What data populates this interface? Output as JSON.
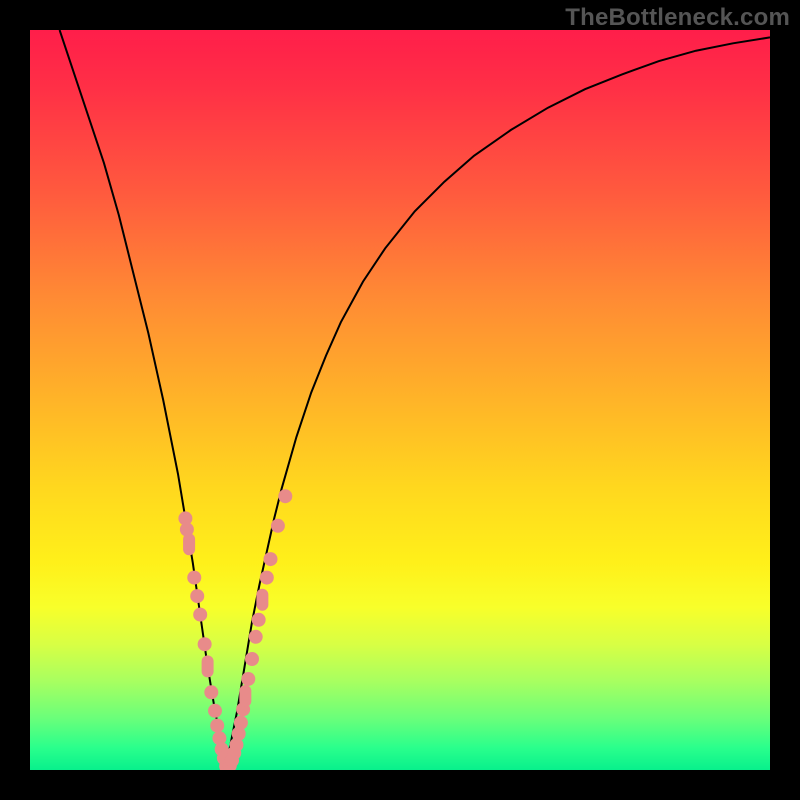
{
  "watermark_text": "TheBottleneck.com",
  "colors": {
    "frame": "#000000",
    "curve": "#000000",
    "points": "#e88b8a",
    "gradient_stops": [
      "#ff1e4a",
      "#ff3046",
      "#ff5a3e",
      "#ff8a34",
      "#ffb428",
      "#ffd81e",
      "#fff01a",
      "#f8ff2a",
      "#d8ff44",
      "#a8ff60",
      "#6aff7a",
      "#2aff8c",
      "#08f08c"
    ]
  },
  "chart_data": {
    "type": "line",
    "title": "",
    "xlabel": "",
    "ylabel": "",
    "xlim": [
      0,
      100
    ],
    "ylim": [
      0,
      100
    ],
    "x_min_curve": 26.5,
    "series": [
      {
        "name": "bottleneck-curve",
        "x": [
          4,
          6,
          8,
          10,
          12,
          14,
          16,
          18,
          20,
          21,
          22,
          23,
          24,
          25,
          26,
          26.5,
          27,
          28,
          29,
          30,
          31,
          32,
          33,
          34,
          36,
          38,
          40,
          42,
          45,
          48,
          52,
          56,
          60,
          65,
          70,
          75,
          80,
          85,
          90,
          95,
          100
        ],
        "y": [
          100,
          94,
          88,
          82,
          75,
          67,
          59,
          50,
          40,
          34,
          28,
          21,
          14,
          8,
          3,
          0.5,
          3,
          8,
          14,
          20,
          25,
          29.5,
          34,
          38,
          45,
          51,
          56,
          60.5,
          66,
          70.5,
          75.5,
          79.5,
          83,
          86.5,
          89.5,
          92,
          94,
          95.8,
          97.2,
          98.2,
          99
        ]
      }
    ],
    "points": [
      {
        "x": 21.0,
        "y": 34.0,
        "shape": "dot"
      },
      {
        "x": 21.2,
        "y": 32.5,
        "shape": "dot"
      },
      {
        "x": 21.5,
        "y": 30.5,
        "shape": "bar"
      },
      {
        "x": 22.2,
        "y": 26.0,
        "shape": "dot"
      },
      {
        "x": 22.6,
        "y": 23.5,
        "shape": "dot"
      },
      {
        "x": 23.0,
        "y": 21.0,
        "shape": "dot"
      },
      {
        "x": 23.6,
        "y": 17.0,
        "shape": "dot"
      },
      {
        "x": 24.0,
        "y": 14.0,
        "shape": "bar"
      },
      {
        "x": 24.5,
        "y": 10.5,
        "shape": "dot"
      },
      {
        "x": 25.0,
        "y": 8.0,
        "shape": "dot"
      },
      {
        "x": 25.3,
        "y": 6.0,
        "shape": "dot"
      },
      {
        "x": 25.6,
        "y": 4.3,
        "shape": "dot"
      },
      {
        "x": 25.9,
        "y": 2.8,
        "shape": "dot"
      },
      {
        "x": 26.2,
        "y": 1.6,
        "shape": "dot"
      },
      {
        "x": 26.5,
        "y": 0.5,
        "shape": "dot"
      },
      {
        "x": 26.7,
        "y": 0.5,
        "shape": "dot"
      },
      {
        "x": 27.0,
        "y": 0.6,
        "shape": "dot"
      },
      {
        "x": 27.3,
        "y": 1.3,
        "shape": "dot"
      },
      {
        "x": 27.6,
        "y": 2.3,
        "shape": "dot"
      },
      {
        "x": 27.9,
        "y": 3.4,
        "shape": "dot"
      },
      {
        "x": 28.2,
        "y": 4.9,
        "shape": "dot"
      },
      {
        "x": 28.5,
        "y": 6.4,
        "shape": "dot"
      },
      {
        "x": 28.8,
        "y": 8.2,
        "shape": "dot"
      },
      {
        "x": 29.1,
        "y": 10.0,
        "shape": "bar"
      },
      {
        "x": 29.5,
        "y": 12.3,
        "shape": "dot"
      },
      {
        "x": 30.0,
        "y": 15.0,
        "shape": "dot"
      },
      {
        "x": 30.5,
        "y": 18.0,
        "shape": "dot"
      },
      {
        "x": 30.9,
        "y": 20.3,
        "shape": "dot"
      },
      {
        "x": 31.4,
        "y": 23.0,
        "shape": "bar"
      },
      {
        "x": 32.0,
        "y": 26.0,
        "shape": "dot"
      },
      {
        "x": 32.5,
        "y": 28.5,
        "shape": "dot"
      },
      {
        "x": 33.5,
        "y": 33.0,
        "shape": "dot"
      },
      {
        "x": 34.5,
        "y": 37.0,
        "shape": "dot"
      }
    ]
  }
}
